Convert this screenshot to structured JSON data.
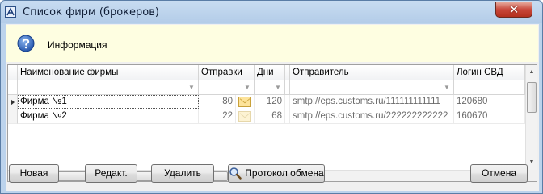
{
  "window": {
    "title": "Список фирм (брокеров)",
    "close_glyph": "✕",
    "app_icon": "app-logo-icon"
  },
  "info": {
    "label": "Информация",
    "icon": "question-icon"
  },
  "grid": {
    "columns": [
      "Наименование фирмы",
      "Отправки",
      "Дни",
      "Отправитель",
      "Логин СВД"
    ],
    "rows": [
      {
        "name": "Фирма №1",
        "sends": "80",
        "days": "120",
        "sender": "smtp://eps.customs.ru/111111111111",
        "login": "120680",
        "selected": true
      },
      {
        "name": "Фирма №2",
        "sends": "22",
        "days": "68",
        "sender": "smtp://eps.customs.ru/222222222222",
        "login": "160670",
        "selected": false
      }
    ]
  },
  "buttons": {
    "new": "Новая",
    "edit": "Редакт.",
    "delete": "Удалить",
    "protocol": "Протокол обмена",
    "cancel": "Отмена"
  },
  "colors": {
    "infobar_bg": "#fefee1",
    "frame": "#bcd3ec",
    "close": "#c8473a"
  }
}
